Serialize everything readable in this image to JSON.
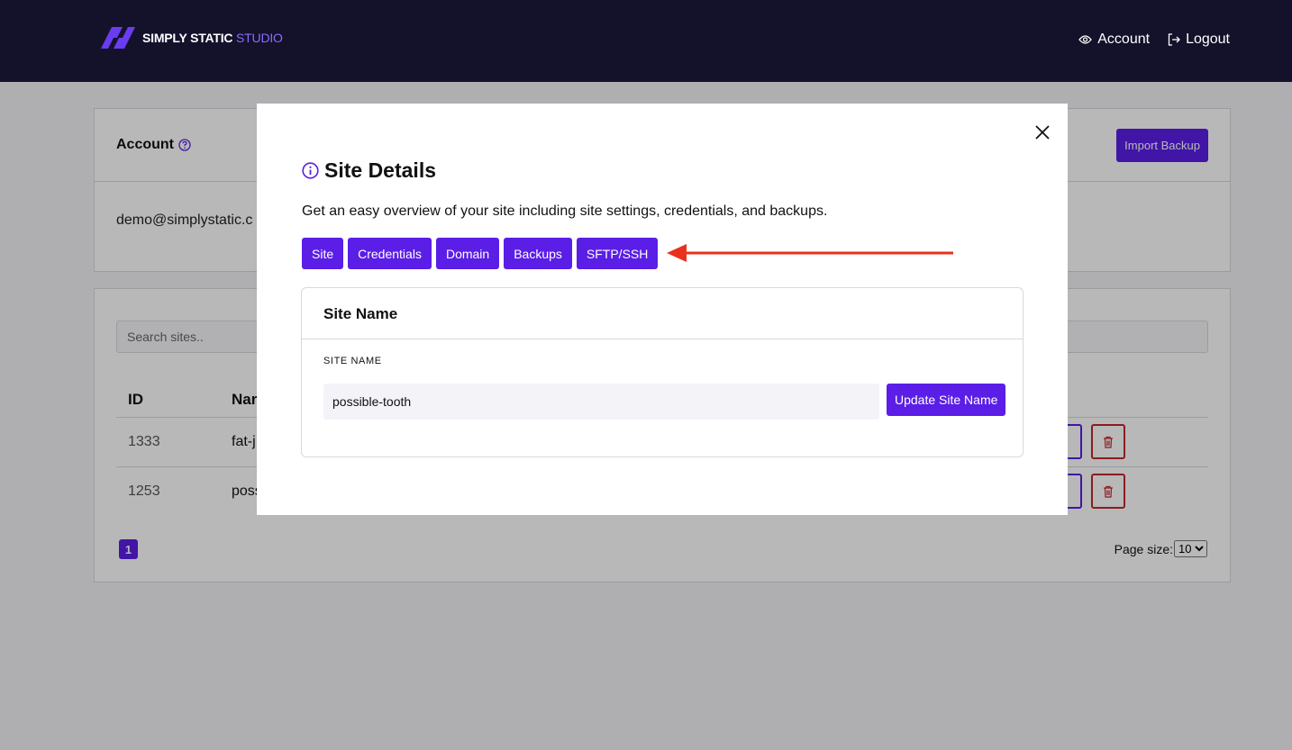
{
  "header": {
    "logo_text_main": "SIMPLY STATIC",
    "logo_text_accent": "STUDIO",
    "nav": [
      {
        "label": "Account",
        "icon": "eye-icon"
      },
      {
        "label": "Logout",
        "icon": "logout-icon"
      }
    ]
  },
  "account_card": {
    "title": "Account",
    "import_button": "Import Backup",
    "email": "demo@simplystatic.c"
  },
  "sites_card": {
    "search_placeholder": "Search sites..",
    "columns": [
      "ID",
      "Nar"
    ],
    "rows": [
      {
        "id": "1333",
        "name": "fat-j"
      },
      {
        "id": "1253",
        "name": "poss"
      }
    ],
    "page": "1",
    "page_size_label": "Page size:",
    "page_size_value": "10"
  },
  "modal": {
    "title": "Site Details",
    "description": "Get an easy overview of your site including site settings, credentials, and backups.",
    "tabs": [
      "Site",
      "Credentials",
      "Domain",
      "Backups",
      "SFTP/SSH"
    ],
    "section_title": "Site Name",
    "field_label": "SITE NAME",
    "field_value": "possible-tooth",
    "update_button": "Update Site Name"
  },
  "colors": {
    "header_bg": "#14112b",
    "accent": "#5b1ee6",
    "danger": "#c0282c",
    "arrow": "#e8321e"
  }
}
